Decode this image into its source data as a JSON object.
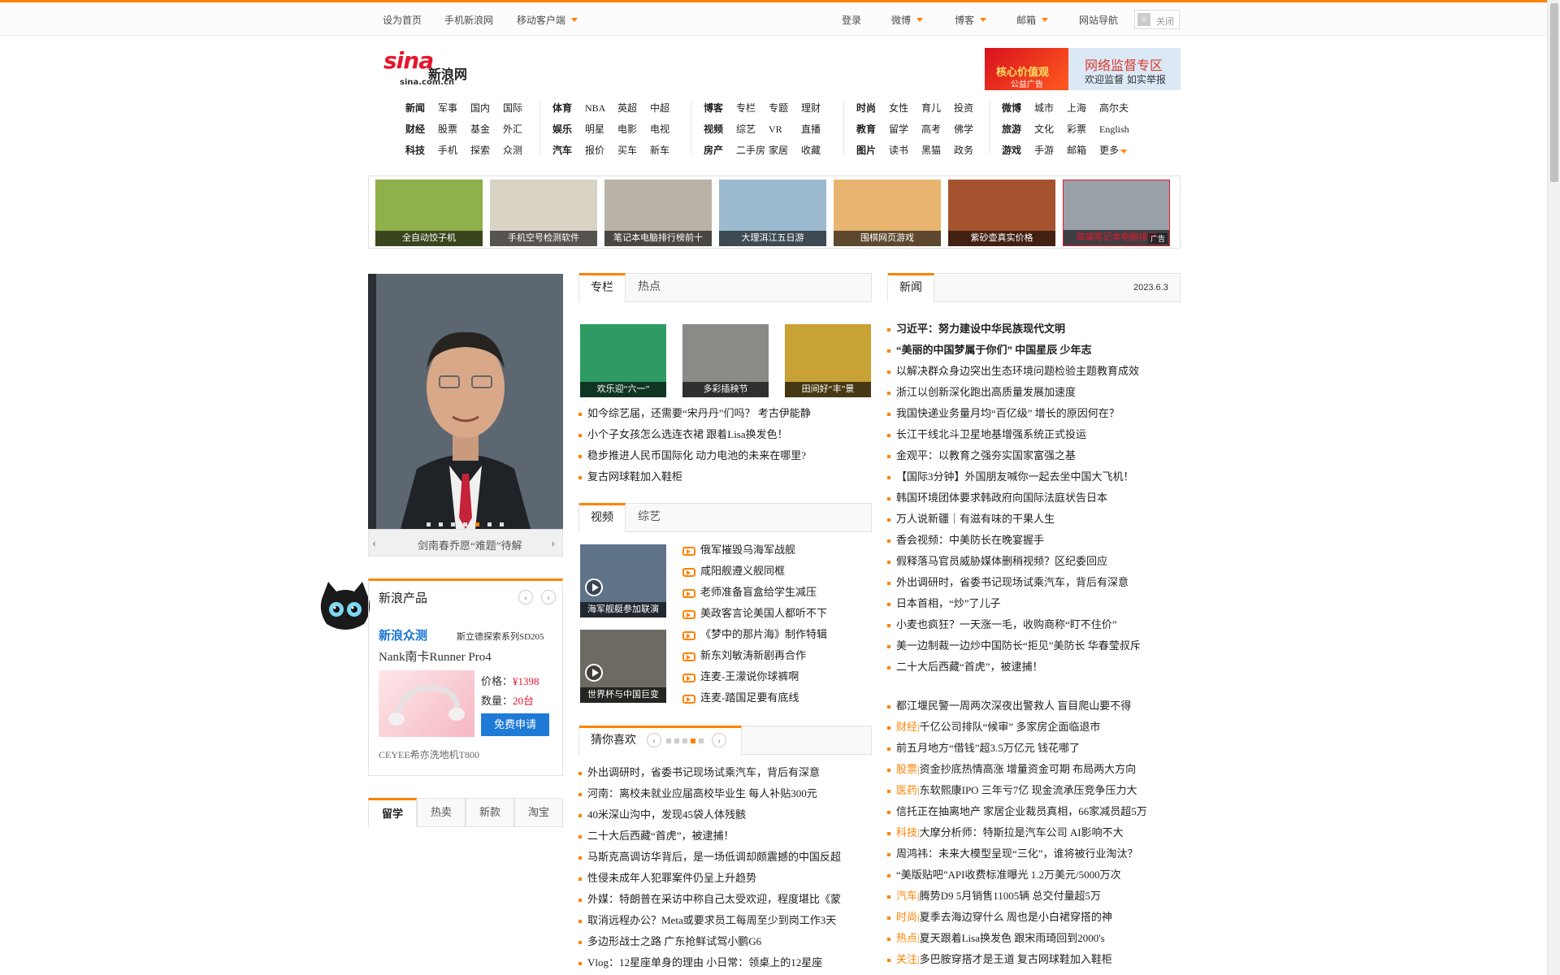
{
  "topbar": {
    "items": [
      {
        "label": "设为首页",
        "caret": false
      },
      {
        "label": "手机新浪网",
        "caret": false
      },
      {
        "label": "移动客户端",
        "caret": true
      },
      {
        "label": "登录",
        "caret": false
      },
      {
        "label": "微博",
        "caret": true
      },
      {
        "label": "博客",
        "caret": true
      },
      {
        "label": "邮箱",
        "caret": true
      },
      {
        "label": "网站导航",
        "caret": false
      }
    ],
    "close_label": "关闭"
  },
  "logo": {
    "mark": "sina",
    "cn": "新浪网",
    "domain": "sina.com.cn"
  },
  "header_banner": {
    "left_line1": "核心价值观",
    "left_line2": "公益广告",
    "right_line1": "网络监督专区",
    "right_line2": "欢迎监督 如实举报"
  },
  "nav": [
    [
      [
        "新闻",
        "军事",
        "国内",
        "国际"
      ],
      [
        "财经",
        "股票",
        "基金",
        "外汇"
      ],
      [
        "科技",
        "手机",
        "探索",
        "众测"
      ]
    ],
    [
      [
        "体育",
        "NBA",
        "英超",
        "中超"
      ],
      [
        "娱乐",
        "明星",
        "电影",
        "电视"
      ],
      [
        "汽车",
        "报价",
        "买车",
        "新车"
      ]
    ],
    [
      [
        "博客",
        "专栏",
        "专题",
        "理财"
      ],
      [
        "视频",
        "综艺",
        "VR",
        "直播"
      ],
      [
        "房产",
        "二手房",
        "家居",
        "收藏"
      ]
    ],
    [
      [
        "时尚",
        "女性",
        "育儿",
        "投资"
      ],
      [
        "教育",
        "留学",
        "高考",
        "佛学"
      ],
      [
        "图片",
        "读书",
        "黑猫",
        "政务"
      ]
    ],
    [
      [
        "微博",
        "城市",
        "上海",
        "高尔夫"
      ],
      [
        "旅游",
        "文化",
        "彩票",
        "English"
      ],
      [
        "游戏",
        "手游",
        "邮箱",
        "更多"
      ]
    ]
  ],
  "strip": [
    {
      "caption": "全自动饺子机",
      "color": "#8fb04a"
    },
    {
      "caption": "手机空号检测软件",
      "color": "#d8d3c5"
    },
    {
      "caption": "笔记本电脑排行榜前十",
      "color": "#b9b2a6"
    },
    {
      "caption": "大理洱江五日游",
      "color": "#9cbad0"
    },
    {
      "caption": "围棋网页游戏",
      "color": "#e8b570"
    },
    {
      "caption": "紫砂壶真实价格",
      "color": "#a5532f"
    },
    {
      "caption": "高端笔记本电脑排行",
      "color": "#9aa0a8"
    }
  ],
  "strip_ad_badge": "广告",
  "slideshow": {
    "caption": "剑南春乔愿“难题”待解",
    "dots": 7,
    "active_dot": 4
  },
  "product": {
    "title": "新浪产品",
    "brand": "新浪众测",
    "subtitle": "斯立德探索系列SD205",
    "name": "Nank南卡Runner Pro4",
    "price_label": "价格：",
    "price": "¥1398",
    "qty_label": "数量：",
    "qty": "20台",
    "apply": "免费申请",
    "next": "CEYEE希亦洗地机T800"
  },
  "study_tabs": [
    "留学",
    "热卖",
    "新款",
    "淘宝"
  ],
  "column": {
    "tab1": "专栏",
    "tab2": "热点",
    "pics": [
      {
        "caption": "欢乐迎“六一”",
        "color": "#2e9b64"
      },
      {
        "caption": "多彩插秧节",
        "color": "#8a8a86"
      },
      {
        "caption": "田间好“丰”景",
        "color": "#c9a236"
      }
    ],
    "list": [
      "如今综艺届，还需要“宋丹丹”们吗？ 考古伊能静",
      "小个子女孩怎么选连衣裙 跟着Lisa换发色！",
      "稳步推进人民币国际化 动力电池的未来在哪里?",
      "复古网球鞋加入鞋柜"
    ]
  },
  "video": {
    "tab1": "视频",
    "tab2": "综艺",
    "thumbs": [
      {
        "caption": "海军舰艇参加联演",
        "color": "#5f7389"
      },
      {
        "caption": "世界杯与中国巨变",
        "color": "#6d6a63"
      }
    ],
    "list": [
      "俄军摧毁乌海军战舰",
      "咸阳舰遵义舰同框",
      "老师准备盲盒给学生减压",
      "美政客言论美国人都听不下",
      "《梦中的那片海》制作特辑",
      "新东刘敏涛新剧再合作",
      "连麦-王濛说你球裤啊",
      "连麦-踏国足要有底线"
    ]
  },
  "guess": {
    "title": "猜你喜欢",
    "dots": 5,
    "active_dot": 3,
    "list": [
      "外出调研时，省委书记现场试乘汽车，背后有深意",
      "河南：离校未就业应届高校毕业生 每人补贴300元",
      "40米深山沟中，发现45袋人体残骸",
      "二十大后西藏“首虎”，被逮捕！",
      "马斯克高调访华背后，是一场低调却颇震撼的中国反超",
      "性侵未成年人犯罪案件仍呈上升趋势",
      "外媒：特朗普在采访中称自己太受欢迎，程度堪比《蒙",
      "取消远程办公？Meta或要求员工每周至少到岗工作3天",
      "多边形战士之路 广东抢鲜试驾小鹏G6",
      "Vlog：12星座单身的理由 小日常：领桌上的12星座"
    ]
  },
  "news": {
    "tab": "新闻",
    "date": "2023.6.3",
    "list": [
      {
        "text": "习近平：努力建设中华民族现代文明",
        "bold": true
      },
      {
        "text": "“美丽的中国梦属于你们” 中国星辰 少年志",
        "bold": true
      },
      {
        "text": "以解决群众身边突出生态环境问题检验主题教育成效"
      },
      {
        "text": "浙江以创新深化跑出高质量发展加速度"
      },
      {
        "text": "我国快递业务量月均“百亿级” 增长的原因何在？"
      },
      {
        "text": "长江干线北斗卫星地基增强系统正式投运"
      },
      {
        "text": "金观平：以教育之强夯实国家富强之基"
      },
      {
        "text": "【国际3分钟】外国朋友喊你一起去坐中国大飞机！"
      },
      {
        "text": "韩国环境团体要求韩政府向国际法庭状告日本"
      },
      {
        "text": "万人说新疆｜有滋有味的干果人生"
      },
      {
        "text": "香会视频：中美防长在晚宴握手"
      },
      {
        "text": "假释落马官员威胁媒体删稍视频？区纪委回应"
      },
      {
        "text": "外出调研时，省委书记现场试乘汽车，背后有深意"
      },
      {
        "text": "日本首相，“炒”了儿子"
      },
      {
        "text": "小麦也疯狂？一天涨一毛，收购商称“盯不住价”"
      },
      {
        "text": "美一边制裁一边炒中国防长“拒见”美防长 华春莹叔斥"
      },
      {
        "text": "二十大后西藏“首虎”，被逮捕！"
      },
      {
        "text": "",
        "gap": true
      },
      {
        "text": "都江堰民警一周两次深夜出警救人 盲目爬山要不得"
      },
      {
        "text": "千亿公司排队“候审” 多家房企面临退市",
        "tag": "财经|"
      },
      {
        "text": "前五月地方“借钱”超3.5万亿元 钱花哪了"
      },
      {
        "text": "资金抄底热情高涨 增量资金可期 布局两大方向",
        "tag": "股票|"
      },
      {
        "text": "东软熙康IPO 三年亏7亿 现金流承压竞争压力大",
        "tag": "医药|"
      },
      {
        "text": "信托正在抽离地产 家居企业裁员真相，66家减员超5万"
      },
      {
        "text": "大摩分析师：特斯拉是汽车公司 AI影响不大",
        "tag": "科技|"
      },
      {
        "text": "周鸿祎：未来大模型呈现“三化”，谁将被行业淘汰？"
      },
      {
        "text": "“美版贴吧”API收费标准曝光 1.2万美元/5000万次"
      },
      {
        "text": "腾势D9 5月销售11005辆 总交付量超5万",
        "tag": "汽车|"
      },
      {
        "text": "夏季去海边穿什么 周也是小白裙穿搭的神",
        "tag": "时尚|"
      },
      {
        "text": "夏天跟着Lisa换发色 跟宋雨琦回到2000's",
        "tag": "热点|"
      },
      {
        "text": "多巴胺穿搭才是王道 复古网球鞋加入鞋柜",
        "tag": "关注|"
      }
    ]
  },
  "colors": {
    "accent": "#ff8200",
    "brand_red": "#e6162d",
    "link_blue": "#1976d2",
    "apply_blue": "#1e7ad6"
  }
}
